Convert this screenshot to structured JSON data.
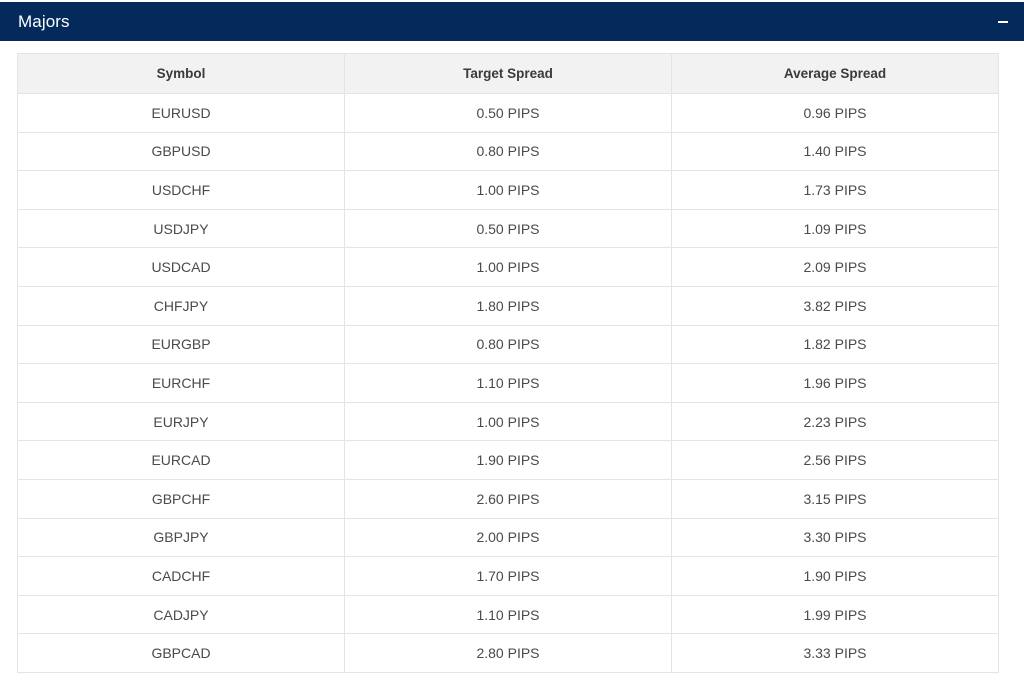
{
  "panel": {
    "title": "Majors",
    "toggle_icon": "minus-icon"
  },
  "table": {
    "columns": [
      "Symbol",
      "Target Spread",
      "Average Spread"
    ],
    "rows": [
      [
        "EURUSD",
        "0.50 PIPS",
        "0.96 PIPS"
      ],
      [
        "GBPUSD",
        "0.80 PIPS",
        "1.40 PIPS"
      ],
      [
        "USDCHF",
        "1.00 PIPS",
        "1.73 PIPS"
      ],
      [
        "USDJPY",
        "0.50 PIPS",
        "1.09 PIPS"
      ],
      [
        "USDCAD",
        "1.00 PIPS",
        "2.09 PIPS"
      ],
      [
        "CHFJPY",
        "1.80 PIPS",
        "3.82 PIPS"
      ],
      [
        "EURGBP",
        "0.80 PIPS",
        "1.82 PIPS"
      ],
      [
        "EURCHF",
        "1.10 PIPS",
        "1.96 PIPS"
      ],
      [
        "EURJPY",
        "1.00 PIPS",
        "2.23 PIPS"
      ],
      [
        "EURCAD",
        "1.90 PIPS",
        "2.56 PIPS"
      ],
      [
        "GBPCHF",
        "2.60 PIPS",
        "3.15 PIPS"
      ],
      [
        "GBPJPY",
        "2.00 PIPS",
        "3.30 PIPS"
      ],
      [
        "CADCHF",
        "1.70 PIPS",
        "1.90 PIPS"
      ],
      [
        "CADJPY",
        "1.10 PIPS",
        "1.99 PIPS"
      ],
      [
        "GBPCAD",
        "2.80 PIPS",
        "3.33 PIPS"
      ]
    ]
  },
  "colors": {
    "header_bg": "#042a5c",
    "table_header_bg": "#f2f2f2",
    "border": "#e4e4e4"
  }
}
